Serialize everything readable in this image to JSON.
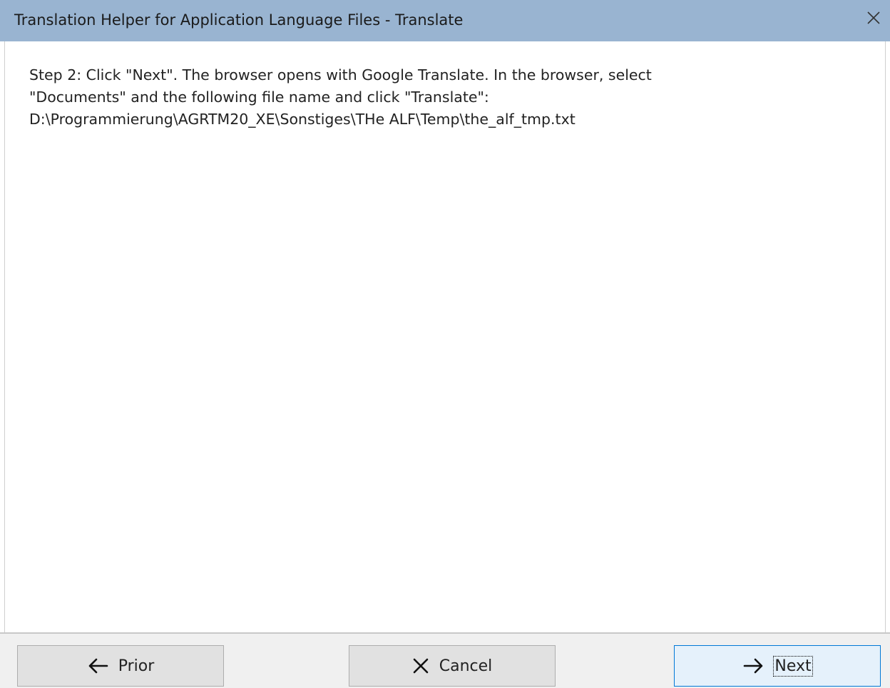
{
  "window": {
    "title": "Translation Helper for Application Language Files - Translate",
    "close_icon": "close-icon"
  },
  "content": {
    "instruction": "Step 2: Click \"Next\". The browser opens with Google Translate. In the browser, select\n\"Documents\" and the following file name and click \"Translate\":\nD:\\Programmierung\\AGRTM20_XE\\Sonstiges\\THe ALF\\Temp\\the_alf_tmp.txt"
  },
  "footer": {
    "prior_label": "Prior",
    "prior_icon": "arrow-left-icon",
    "cancel_label": "Cancel",
    "cancel_icon": "x-icon",
    "next_label": "Next",
    "next_icon": "arrow-right-icon",
    "focused_button": "Next"
  },
  "colors": {
    "titlebar": "#99b4d1",
    "button_face": "#e1e1e1",
    "default_button_border": "#0078d7",
    "default_button_face": "#e5f1fb"
  }
}
